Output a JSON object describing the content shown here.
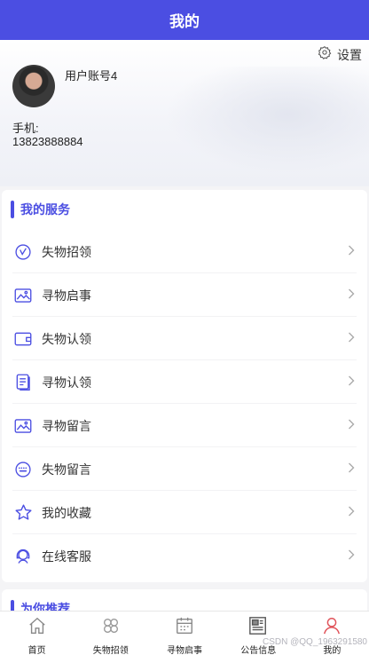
{
  "header": {
    "title": "我的"
  },
  "profile": {
    "settings_label": "设置",
    "username": "用户账号4",
    "phone_label": "手机:",
    "phone": "13823888884"
  },
  "services": {
    "title": "我的服务",
    "items": [
      {
        "label": "失物招领",
        "icon": "clock-check-icon"
      },
      {
        "label": "寻物启事",
        "icon": "picture-icon"
      },
      {
        "label": "失物认领",
        "icon": "wallet-icon"
      },
      {
        "label": "寻物认领",
        "icon": "document-icon"
      },
      {
        "label": "寻物留言",
        "icon": "picture-icon"
      },
      {
        "label": "失物留言",
        "icon": "keyboard-icon"
      },
      {
        "label": "我的收藏",
        "icon": "star-icon"
      },
      {
        "label": "在线客服",
        "icon": "customer-service-icon"
      }
    ]
  },
  "recommend": {
    "title": "为你推荐"
  },
  "tabbar": [
    {
      "label": "首页",
      "icon": "home-icon"
    },
    {
      "label": "失物招领",
      "icon": "clover-icon"
    },
    {
      "label": "寻物启事",
      "icon": "calendar-icon"
    },
    {
      "label": "公告信息",
      "icon": "newspaper-icon"
    },
    {
      "label": "我的",
      "icon": "user-icon",
      "active": true
    }
  ],
  "watermark": "CSDN @QQ_1963291580",
  "colors": {
    "primary": "#4b4ee2",
    "active_tab": "#e0535a"
  }
}
